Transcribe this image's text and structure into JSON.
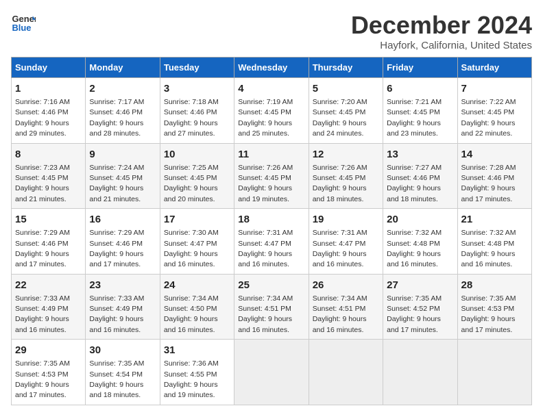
{
  "logo": {
    "line1": "General",
    "line2": "Blue"
  },
  "title": "December 2024",
  "subtitle": "Hayfork, California, United States",
  "days_of_week": [
    "Sunday",
    "Monday",
    "Tuesday",
    "Wednesday",
    "Thursday",
    "Friday",
    "Saturday"
  ],
  "weeks": [
    [
      {
        "day": "1",
        "info": "Sunrise: 7:16 AM\nSunset: 4:46 PM\nDaylight: 9 hours and 29 minutes."
      },
      {
        "day": "2",
        "info": "Sunrise: 7:17 AM\nSunset: 4:46 PM\nDaylight: 9 hours and 28 minutes."
      },
      {
        "day": "3",
        "info": "Sunrise: 7:18 AM\nSunset: 4:46 PM\nDaylight: 9 hours and 27 minutes."
      },
      {
        "day": "4",
        "info": "Sunrise: 7:19 AM\nSunset: 4:45 PM\nDaylight: 9 hours and 25 minutes."
      },
      {
        "day": "5",
        "info": "Sunrise: 7:20 AM\nSunset: 4:45 PM\nDaylight: 9 hours and 24 minutes."
      },
      {
        "day": "6",
        "info": "Sunrise: 7:21 AM\nSunset: 4:45 PM\nDaylight: 9 hours and 23 minutes."
      },
      {
        "day": "7",
        "info": "Sunrise: 7:22 AM\nSunset: 4:45 PM\nDaylight: 9 hours and 22 minutes."
      }
    ],
    [
      {
        "day": "8",
        "info": "Sunrise: 7:23 AM\nSunset: 4:45 PM\nDaylight: 9 hours and 21 minutes."
      },
      {
        "day": "9",
        "info": "Sunrise: 7:24 AM\nSunset: 4:45 PM\nDaylight: 9 hours and 21 minutes."
      },
      {
        "day": "10",
        "info": "Sunrise: 7:25 AM\nSunset: 4:45 PM\nDaylight: 9 hours and 20 minutes."
      },
      {
        "day": "11",
        "info": "Sunrise: 7:26 AM\nSunset: 4:45 PM\nDaylight: 9 hours and 19 minutes."
      },
      {
        "day": "12",
        "info": "Sunrise: 7:26 AM\nSunset: 4:45 PM\nDaylight: 9 hours and 18 minutes."
      },
      {
        "day": "13",
        "info": "Sunrise: 7:27 AM\nSunset: 4:46 PM\nDaylight: 9 hours and 18 minutes."
      },
      {
        "day": "14",
        "info": "Sunrise: 7:28 AM\nSunset: 4:46 PM\nDaylight: 9 hours and 17 minutes."
      }
    ],
    [
      {
        "day": "15",
        "info": "Sunrise: 7:29 AM\nSunset: 4:46 PM\nDaylight: 9 hours and 17 minutes."
      },
      {
        "day": "16",
        "info": "Sunrise: 7:29 AM\nSunset: 4:46 PM\nDaylight: 9 hours and 17 minutes."
      },
      {
        "day": "17",
        "info": "Sunrise: 7:30 AM\nSunset: 4:47 PM\nDaylight: 9 hours and 16 minutes."
      },
      {
        "day": "18",
        "info": "Sunrise: 7:31 AM\nSunset: 4:47 PM\nDaylight: 9 hours and 16 minutes."
      },
      {
        "day": "19",
        "info": "Sunrise: 7:31 AM\nSunset: 4:47 PM\nDaylight: 9 hours and 16 minutes."
      },
      {
        "day": "20",
        "info": "Sunrise: 7:32 AM\nSunset: 4:48 PM\nDaylight: 9 hours and 16 minutes."
      },
      {
        "day": "21",
        "info": "Sunrise: 7:32 AM\nSunset: 4:48 PM\nDaylight: 9 hours and 16 minutes."
      }
    ],
    [
      {
        "day": "22",
        "info": "Sunrise: 7:33 AM\nSunset: 4:49 PM\nDaylight: 9 hours and 16 minutes."
      },
      {
        "day": "23",
        "info": "Sunrise: 7:33 AM\nSunset: 4:49 PM\nDaylight: 9 hours and 16 minutes."
      },
      {
        "day": "24",
        "info": "Sunrise: 7:34 AM\nSunset: 4:50 PM\nDaylight: 9 hours and 16 minutes."
      },
      {
        "day": "25",
        "info": "Sunrise: 7:34 AM\nSunset: 4:51 PM\nDaylight: 9 hours and 16 minutes."
      },
      {
        "day": "26",
        "info": "Sunrise: 7:34 AM\nSunset: 4:51 PM\nDaylight: 9 hours and 16 minutes."
      },
      {
        "day": "27",
        "info": "Sunrise: 7:35 AM\nSunset: 4:52 PM\nDaylight: 9 hours and 17 minutes."
      },
      {
        "day": "28",
        "info": "Sunrise: 7:35 AM\nSunset: 4:53 PM\nDaylight: 9 hours and 17 minutes."
      }
    ],
    [
      {
        "day": "29",
        "info": "Sunrise: 7:35 AM\nSunset: 4:53 PM\nDaylight: 9 hours and 17 minutes."
      },
      {
        "day": "30",
        "info": "Sunrise: 7:35 AM\nSunset: 4:54 PM\nDaylight: 9 hours and 18 minutes."
      },
      {
        "day": "31",
        "info": "Sunrise: 7:36 AM\nSunset: 4:55 PM\nDaylight: 9 hours and 19 minutes."
      },
      null,
      null,
      null,
      null
    ]
  ]
}
